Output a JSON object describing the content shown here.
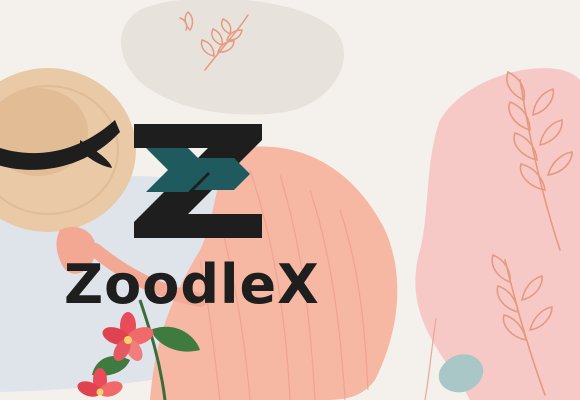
{
  "brand": {
    "name": "ZoodleX",
    "logo_icon": "zz-monogram-icon"
  },
  "colors": {
    "background": "#f4f1ec",
    "pink_blob": "#f7c9c6",
    "gray_blob": "#e7e3dc",
    "blue_blob": "#dfe4ea",
    "dress": "#f6b7a3",
    "hat": "#e9c9a6",
    "teal_leaf": "#a9c7c6",
    "logo_dark": "#1e1e1e",
    "logo_teal": "#1f5b5e",
    "botanical_line": "#e59a80"
  },
  "icons": [
    "straw-hat-icon",
    "dress-icon",
    "flower-icon",
    "botanical-branch-icon"
  ]
}
